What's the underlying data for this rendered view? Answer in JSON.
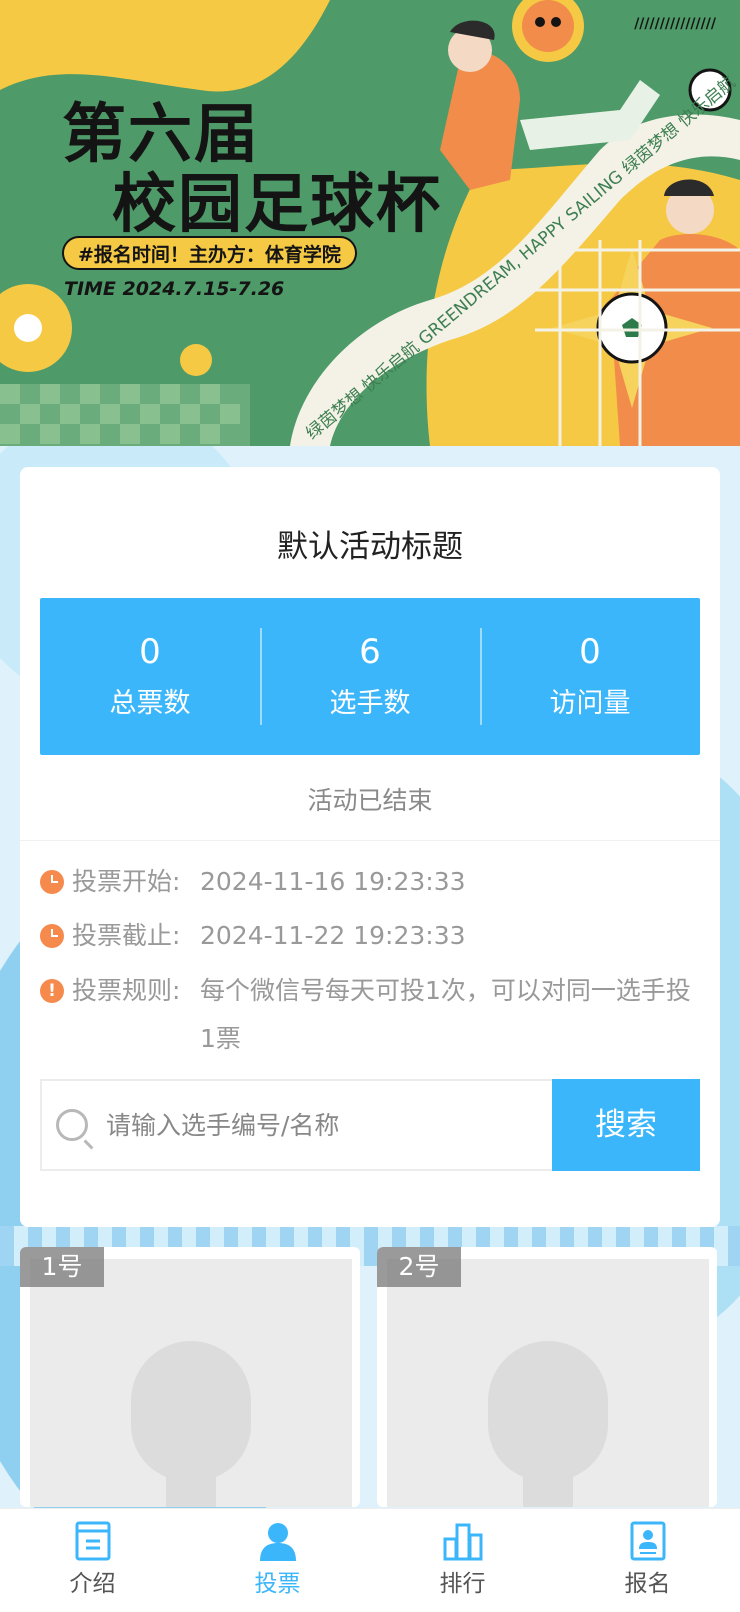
{
  "banner": {
    "title_line1": "第六届",
    "title_line2": "校园足球杯",
    "tag": "#报名时间！主办方：体育学院",
    "time": "TIME 2024.7.15-7.26",
    "ribbon_text": "绿茵梦想  快乐启航  GREENDREAM, HAPPY SAILING  绿茵梦想  快乐启航",
    "stripes": "////////////////"
  },
  "activity": {
    "title": "默认活动标题",
    "status": "活动已结束"
  },
  "stats": [
    {
      "value": "0",
      "label": "总票数"
    },
    {
      "value": "6",
      "label": "选手数"
    },
    {
      "value": "0",
      "label": "访问量"
    }
  ],
  "info": {
    "start_label": "投票开始:",
    "start_value": "2024-11-16 19:23:33",
    "end_label": "投票截止:",
    "end_value": "2024-11-22 19:23:33",
    "rules_label": "投票规则:",
    "rules_value": "每个微信号每天可投1次，可以对同一选手投1票",
    "rules_icon": "!"
  },
  "search": {
    "placeholder": "请输入选手编号/名称",
    "button_label": "搜索"
  },
  "contestants": [
    {
      "number": "1号"
    },
    {
      "number": "2号"
    }
  ],
  "tabbar": {
    "items": [
      {
        "label": "介绍",
        "icon": "intro-icon"
      },
      {
        "label": "投票",
        "icon": "user-icon",
        "active": true
      },
      {
        "label": "排行",
        "icon": "ranking-icon"
      },
      {
        "label": "报名",
        "icon": "signup-icon"
      }
    ]
  },
  "colors": {
    "accent": "#3cb6fa",
    "info_icon": "#f58a4c",
    "banner_green": "#4e9a68",
    "banner_yellow": "#f6c944"
  }
}
